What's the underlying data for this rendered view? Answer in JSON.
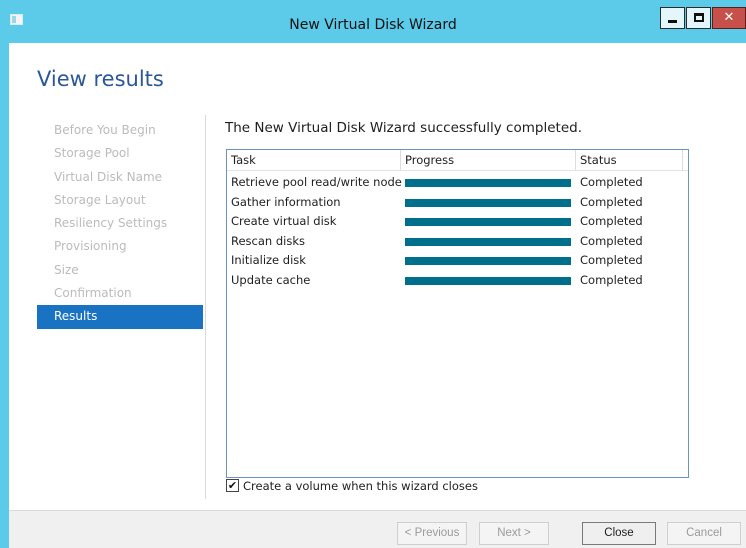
{
  "window": {
    "title": "New Virtual Disk Wizard",
    "accent": "#5ccbe9"
  },
  "page": {
    "heading": "View results",
    "message": "The New Virtual Disk Wizard successfully completed."
  },
  "nav": {
    "items": [
      {
        "label": "Before You Begin"
      },
      {
        "label": "Storage Pool"
      },
      {
        "label": "Virtual Disk Name"
      },
      {
        "label": "Storage Layout"
      },
      {
        "label": "Resiliency Settings"
      },
      {
        "label": "Provisioning"
      },
      {
        "label": "Size"
      },
      {
        "label": "Confirmation"
      },
      {
        "label": "Results",
        "active": true
      }
    ]
  },
  "table": {
    "columns": [
      "Task",
      "Progress",
      "Status"
    ],
    "rows": [
      {
        "task": "Retrieve pool read/write node",
        "progress": 100,
        "status": "Completed"
      },
      {
        "task": "Gather information",
        "progress": 100,
        "status": "Completed"
      },
      {
        "task": "Create virtual disk",
        "progress": 100,
        "status": "Completed"
      },
      {
        "task": "Rescan disks",
        "progress": 100,
        "status": "Completed"
      },
      {
        "task": "Initialize disk",
        "progress": 100,
        "status": "Completed"
      },
      {
        "task": "Update cache",
        "progress": 100,
        "status": "Completed"
      }
    ]
  },
  "options": {
    "create_volume_label": "Create a volume when this wizard closes",
    "create_volume_checked": true
  },
  "buttons": {
    "previous": "< Previous",
    "next": "Next >",
    "close": "Close",
    "cancel": "Cancel"
  },
  "icons": {
    "window_menu": "window-icon",
    "minimize": "minimize-icon",
    "maximize": "maximize-icon",
    "close": "close-icon",
    "check": "✔"
  },
  "colors": {
    "heading": "#2b5797",
    "selection": "#1a73c2",
    "progress_fill": "#006f8c",
    "close_button": "#c7504a"
  }
}
